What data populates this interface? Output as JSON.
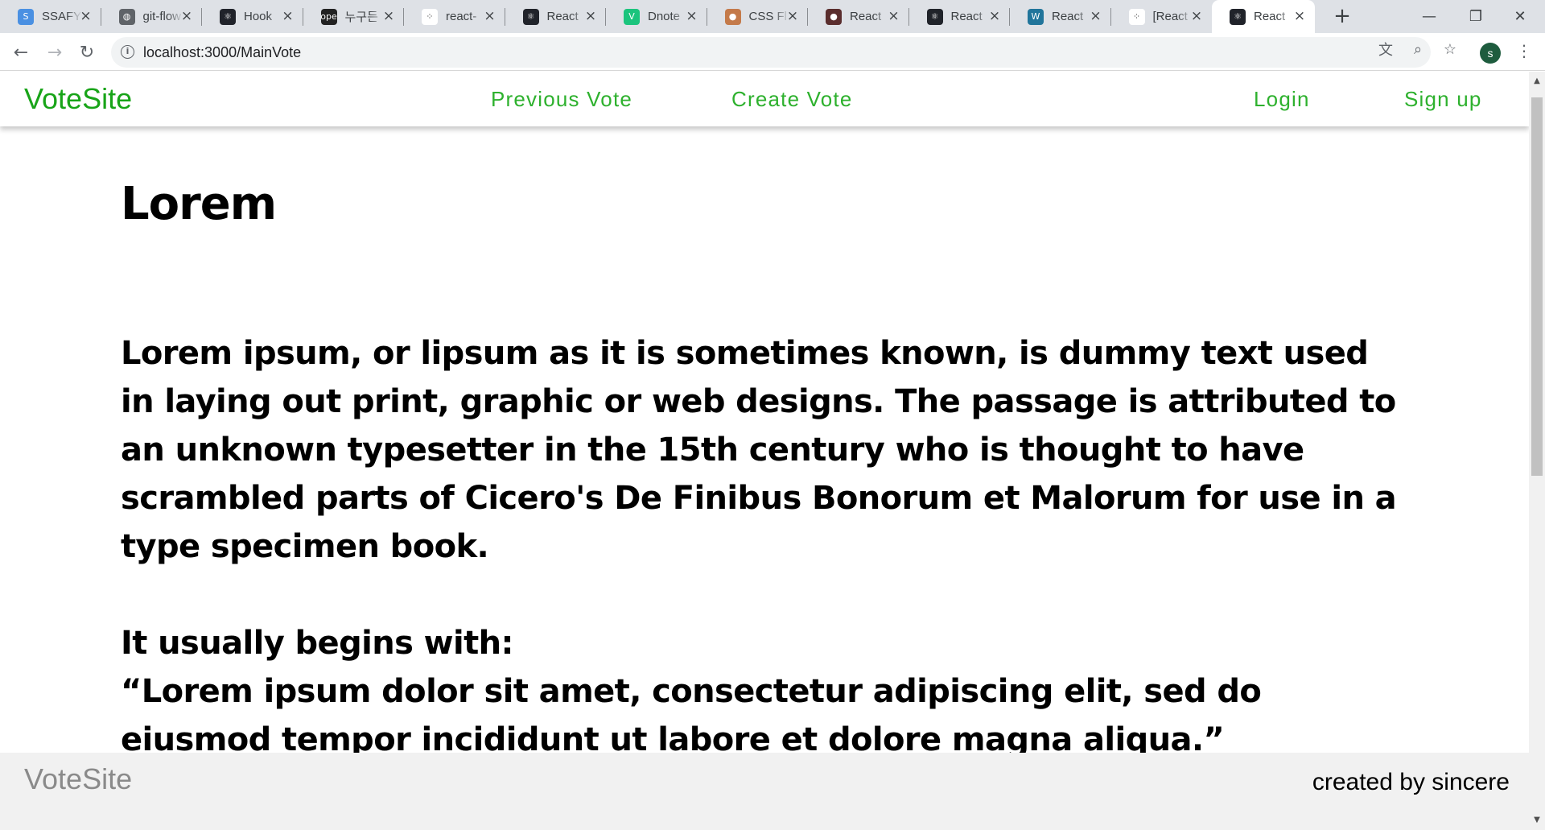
{
  "browser": {
    "tabs": [
      {
        "title": "SSAFY",
        "favicon_color": "#4a90e2",
        "favicon_glyph": "S",
        "active": false
      },
      {
        "title": "git-flow",
        "favicon_color": "#5f6368",
        "favicon_glyph": "◍",
        "active": false
      },
      {
        "title": "Hook",
        "favicon_color": "#20232a",
        "favicon_glyph": "⚛",
        "active": false
      },
      {
        "title": "누구든",
        "favicon_color": "#222222",
        "favicon_glyph": "ope",
        "active": false
      },
      {
        "title": "react-",
        "favicon_color": "#ffffff",
        "favicon_glyph": "⁘",
        "active": false
      },
      {
        "title": "React",
        "favicon_color": "#20232a",
        "favicon_glyph": "⚛",
        "active": false
      },
      {
        "title": "Dnote",
        "favicon_color": "#1bc47d",
        "favicon_glyph": "V",
        "active": false
      },
      {
        "title": "CSS Fl",
        "favicon_color": "#c47a4a",
        "favicon_glyph": "●",
        "active": false
      },
      {
        "title": "React",
        "favicon_color": "#5a2d2d",
        "favicon_glyph": "●",
        "active": false
      },
      {
        "title": "React",
        "favicon_color": "#20232a",
        "favicon_glyph": "⚛",
        "active": false
      },
      {
        "title": "React",
        "favicon_color": "#21759b",
        "favicon_glyph": "W",
        "active": false
      },
      {
        "title": "[React",
        "favicon_color": "#ffffff",
        "favicon_glyph": "⁘",
        "active": false
      },
      {
        "title": "React",
        "favicon_color": "#20232a",
        "favicon_glyph": "⚛",
        "active": true
      }
    ],
    "address": "localhost:3000/MainVote",
    "profile_initial": "s"
  },
  "site": {
    "brand": "VoteSite",
    "brand_color": "#18a418",
    "nav": {
      "previous_vote": "Previous Vote",
      "create_vote": "Create Vote",
      "login": "Login",
      "signup": "Sign up"
    }
  },
  "content": {
    "title": "Lorem",
    "paragraph1": "Lorem ipsum, or lipsum as it is sometimes known, is dummy text used in laying out print, graphic or web designs. The passage is attributed to an unknown typesetter in the 15th century who is thought to have scrambled parts of Cicero's De Finibus Bonorum et Malorum for use in a type specimen book.",
    "paragraph2_lead": "It usually begins with:",
    "paragraph2_quote": "“Lorem ipsum dolor sit amet, consectetur adipiscing elit, sed do eiusmod tempor incididunt ut labore et dolore magna aliqua.”"
  },
  "footer": {
    "brand": "VoteSite",
    "credit": "created by sincere"
  }
}
